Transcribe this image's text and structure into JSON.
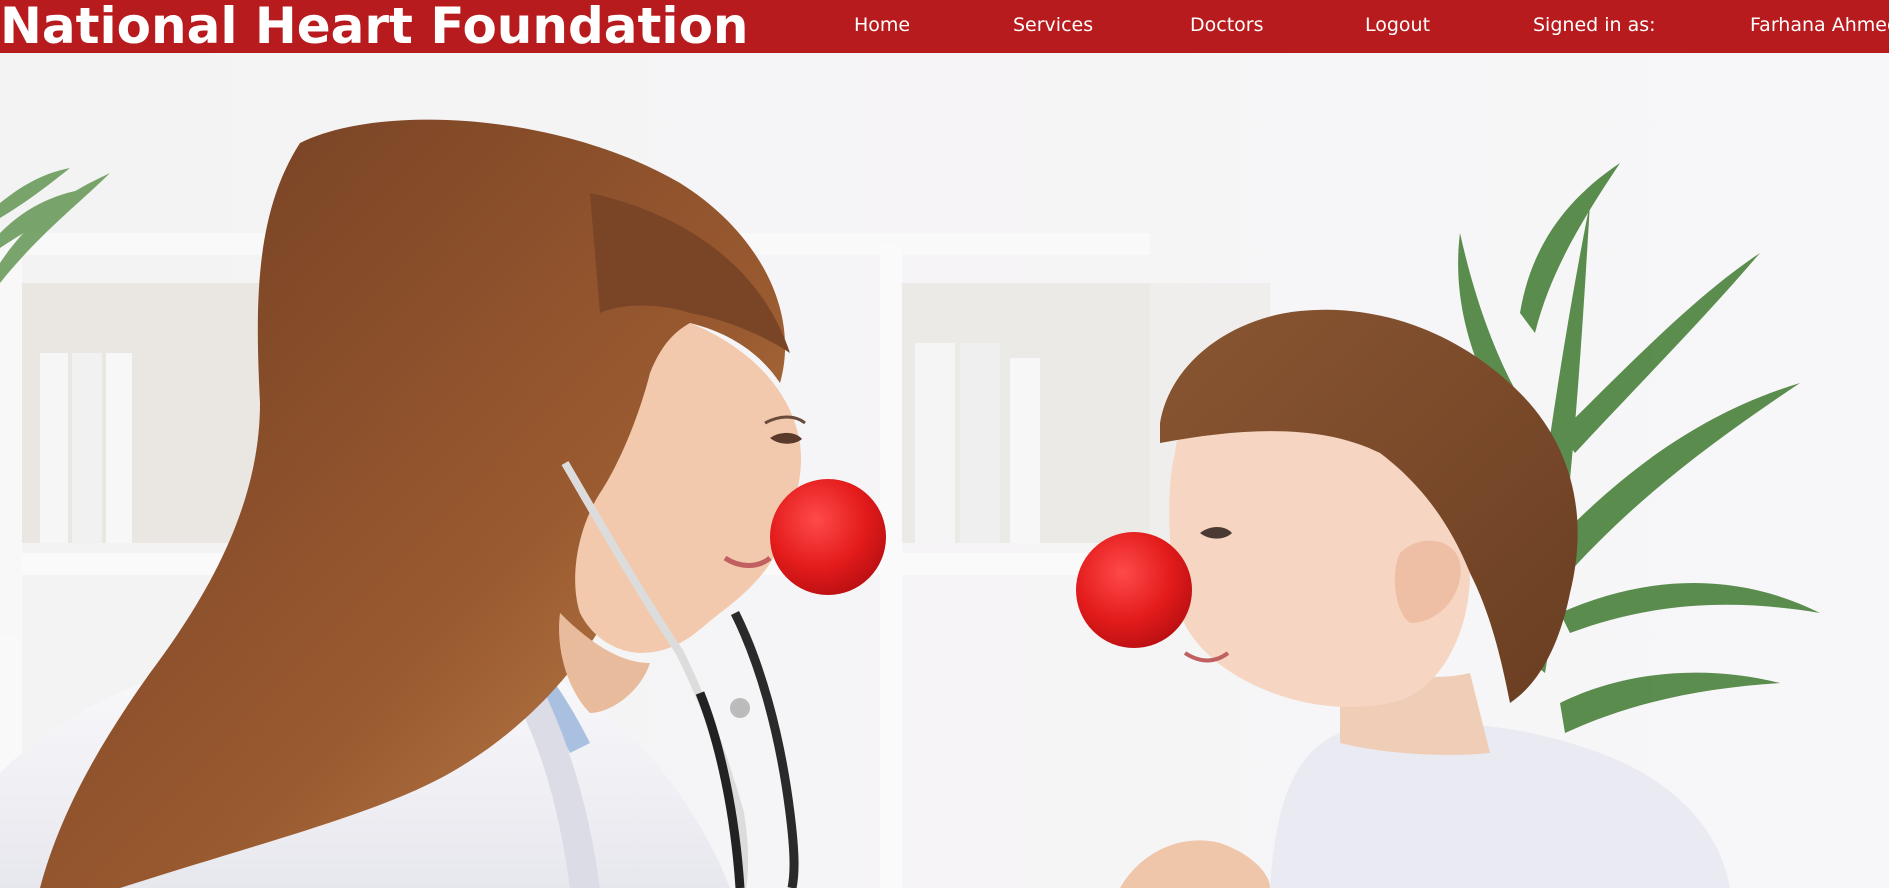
{
  "header": {
    "brand": "National Heart Foundation",
    "nav": {
      "home": "Home",
      "services": "Services",
      "doctors": "Doctors",
      "logout": "Logout"
    },
    "signed_in_label": "Signed in as:",
    "user_name": "Farhana Ahmed"
  },
  "colors": {
    "header_bg": "#b81b1d",
    "header_text": "#ffffff"
  },
  "hero": {
    "image_subject": "doctor-and-child-clown-noses"
  }
}
